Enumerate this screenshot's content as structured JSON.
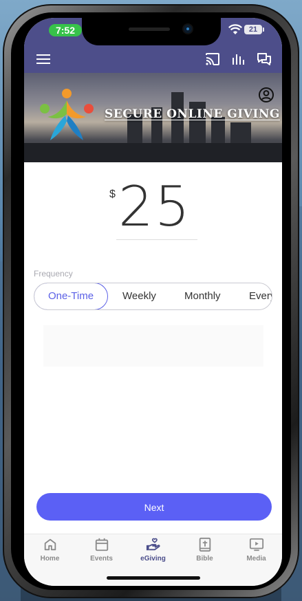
{
  "status_bar": {
    "time": "7:52",
    "battery": "21"
  },
  "banner": {
    "title": "SECURE ONLINE GIVING"
  },
  "giving": {
    "currency_symbol": "$",
    "amount": "25",
    "frequency_label": "Frequency",
    "frequencies": [
      "One-Time",
      "Weekly",
      "Monthly",
      "Every"
    ],
    "selected_frequency": "One-Time",
    "next_label": "Next"
  },
  "tabs": [
    {
      "label": "Home",
      "icon": "home-icon"
    },
    {
      "label": "Events",
      "icon": "calendar-icon"
    },
    {
      "label": "eGiving",
      "icon": "giving-hand-icon",
      "active": true
    },
    {
      "label": "Bible",
      "icon": "bible-icon"
    },
    {
      "label": "Media",
      "icon": "media-play-icon"
    }
  ],
  "colors": {
    "header": "#4d4e8a",
    "accent": "#5b60f5",
    "time_pill": "#37c24a",
    "active_tab": "#4a4d8a"
  }
}
